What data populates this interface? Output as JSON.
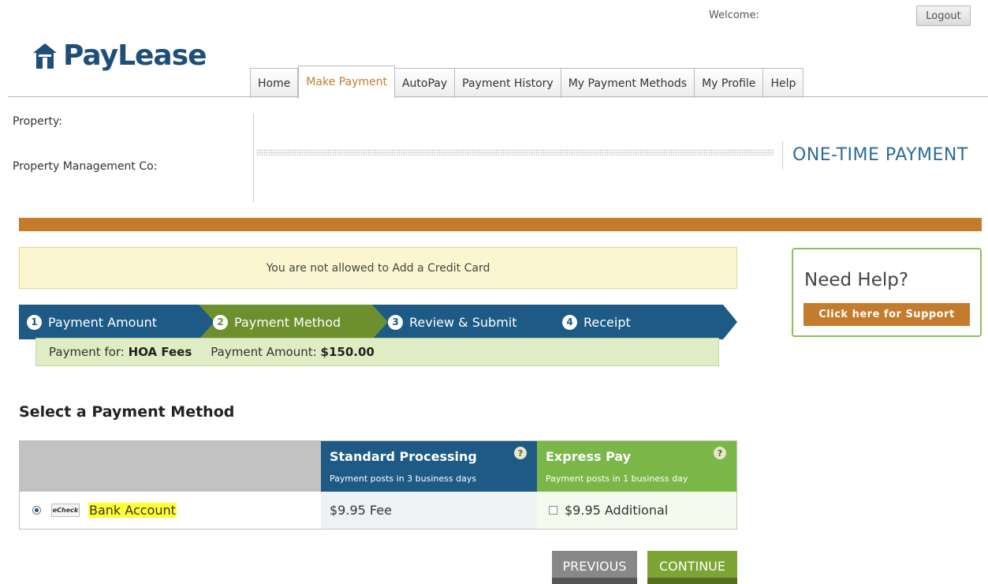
{
  "header": {
    "welcome": "Welcome:",
    "logout": "Logout",
    "logo": "PayLease"
  },
  "tabs": [
    {
      "label": "Home"
    },
    {
      "label": "Make Payment",
      "active": true
    },
    {
      "label": "AutoPay"
    },
    {
      "label": "Payment History"
    },
    {
      "label": "My Payment Methods"
    },
    {
      "label": "My Profile"
    },
    {
      "label": "Help"
    }
  ],
  "property": {
    "property_label": "Property:",
    "management_label": "Property Management Co:",
    "page_heading": "ONE-TIME PAYMENT"
  },
  "notice": "You are not allowed to Add a Credit Card",
  "help": {
    "title": "Need Help?",
    "button": "Click here for Support"
  },
  "steps": [
    {
      "num": "1",
      "label": "Payment Amount"
    },
    {
      "num": "2",
      "label": "Payment Method",
      "active": true
    },
    {
      "num": "3",
      "label": "Review & Submit"
    },
    {
      "num": "4",
      "label": "Receipt"
    }
  ],
  "summary": {
    "for_label": "Payment for:",
    "for_value": "HOA Fees",
    "amount_label": "Payment Amount:",
    "amount_value": "$150.00"
  },
  "section_title": "Select a Payment Method",
  "table": {
    "standard": {
      "title": "Standard Processing",
      "sub": "Payment posts in 3 business days"
    },
    "express": {
      "title": "Express Pay",
      "sub": "Payment posts in 1 business day"
    },
    "help_mark": "?",
    "row": {
      "echeck": "eCheck",
      "method": "Bank Account",
      "standard_fee": "$9.95 Fee",
      "express_fee": "$9.95 Additional"
    }
  },
  "buttons": {
    "previous": "PREVIOUS",
    "continue": "CONTINUE"
  },
  "colors": {
    "brand_blue": "#1d5a85",
    "brand_orange": "#c47b2c",
    "brand_green": "#7ab648",
    "highlight": "#ffff33"
  },
  "icons": {
    "logo": "house-icon",
    "help": "question-icon"
  }
}
